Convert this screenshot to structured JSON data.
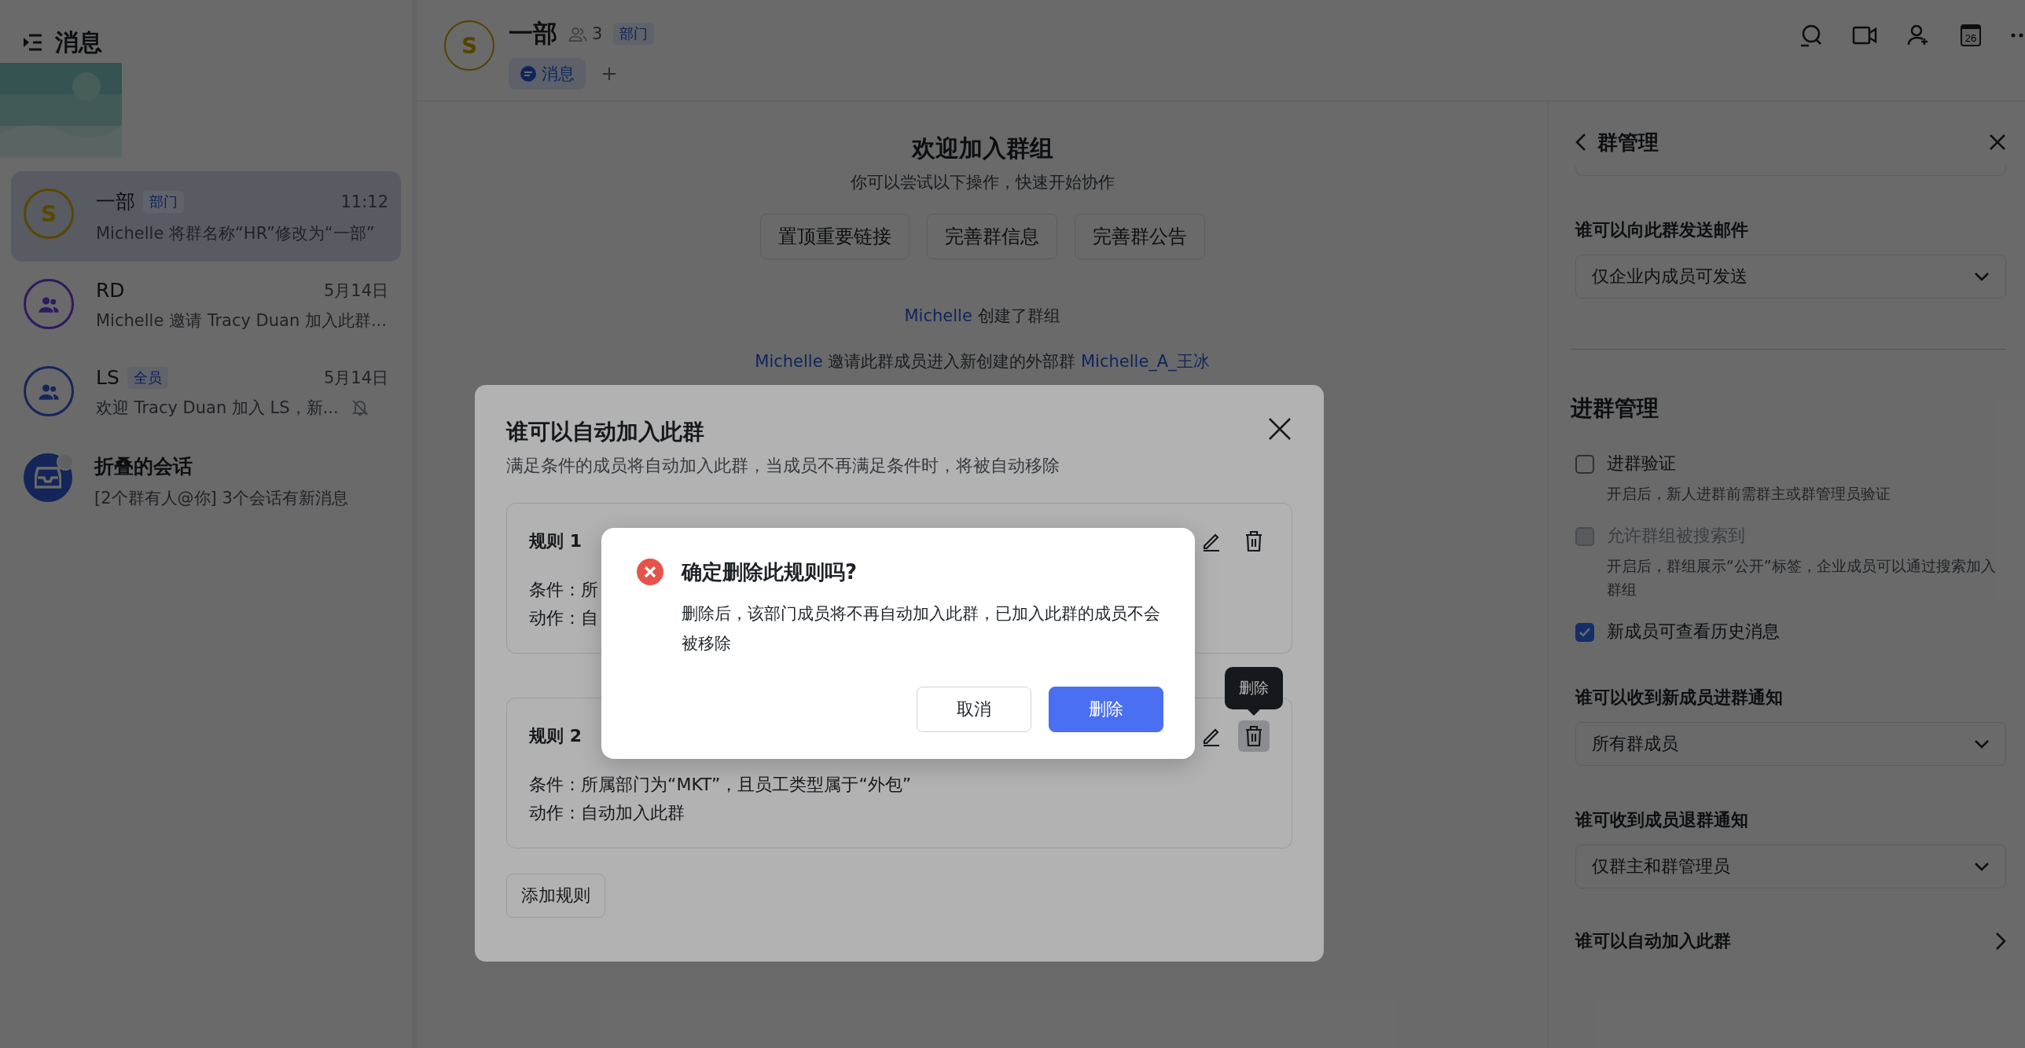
{
  "sidebar": {
    "title": "消息",
    "chats": [
      {
        "kind": "letter",
        "avatar_letter": "S",
        "color": "#5a4800",
        "name": "一部",
        "tag": "部门",
        "time": "11:12",
        "preview": "Michelle 将群名称“HR”修改为“一部”",
        "selected": true,
        "muted": false,
        "unread_dot": false
      },
      {
        "kind": "people",
        "color": "#2e1b60",
        "name": "RD",
        "time": "5月14日",
        "preview": "Michelle 邀请 Tracy Duan 加入此群...",
        "selected": false,
        "muted": false,
        "unread_dot": false
      },
      {
        "kind": "people",
        "color": "#16275c",
        "name": "LS",
        "tag": "全员",
        "time": "5月14日",
        "preview": "欢迎 Tracy Duan 加入 LS，新...",
        "selected": false,
        "muted": true,
        "unread_dot": false
      },
      {
        "kind": "folded",
        "color": "#14265a",
        "name": "折叠的会话",
        "preview": "[2个群有人@你] 3个会话有新消息",
        "selected": false,
        "muted": false,
        "unread_dot": true
      }
    ]
  },
  "chat": {
    "avatar_letter": "S",
    "title": "一部",
    "member_count": "3",
    "tag": "部门",
    "tabs": [
      {
        "label": "消息",
        "selected": true
      }
    ],
    "calendar_day": "26",
    "welcome": {
      "title": "欢迎加入群组",
      "subtitle": "你可以尝试以下操作，快速开始协作",
      "actions": [
        "置顶重要链接",
        "完善群信息",
        "完善群公告"
      ]
    },
    "events": [
      {
        "actor": "Michelle",
        "text": "创建了群组"
      },
      {
        "actor": "Michelle",
        "text": "邀请此群成员进入新创建的外部群",
        "target": "Michelle_A_王冰"
      }
    ]
  },
  "panel": {
    "title": "群管理",
    "items": [
      {
        "kind": "cutoff"
      },
      {
        "kind": "label",
        "text": "谁可以向此群发送邮件"
      },
      {
        "kind": "select",
        "value": "仅企业内成员可发送"
      },
      {
        "kind": "divider"
      },
      {
        "kind": "heading",
        "text": "进群管理"
      },
      {
        "kind": "checkbox",
        "label": "进群验证",
        "description": "开启后，新人进群前需群主或群管理员验证",
        "checked": false,
        "disabled": false
      },
      {
        "kind": "checkbox",
        "label": "允许群组被搜索到",
        "description": "开启后，群组展示“公开”标签，企业成员可以通过搜索加入群组",
        "checked": false,
        "disabled": true
      },
      {
        "kind": "checkbox",
        "label": "新成员可查看历史消息",
        "checked": true,
        "disabled": false
      },
      {
        "kind": "label",
        "text": "谁可以收到新成员进群通知"
      },
      {
        "kind": "select",
        "value": "所有群成员"
      },
      {
        "kind": "label",
        "text": "谁可收到成员退群通知"
      },
      {
        "kind": "select",
        "value": "仅群主和群管理员"
      },
      {
        "kind": "link",
        "text": "谁可以自动加入此群"
      }
    ]
  },
  "modal": {
    "title": "谁可以自动加入此群",
    "subtitle": "满足条件的成员将自动加入此群，当成员不再满足条件时，将被自动移除",
    "rules": [
      {
        "name": "规则 1",
        "condition_label": "条件：",
        "condition": "所",
        "action_label": "动作：",
        "action": "自",
        "delete_hovered": false
      },
      {
        "name": "规则 2",
        "condition_label": "条件：",
        "condition": "所属部门为“MKT”，且员工类型属于“外包”",
        "action_label": "动作：",
        "action": "自动加入此群",
        "delete_hovered": true,
        "tooltip": "删除"
      }
    ],
    "add_button": "添加规则"
  },
  "confirm": {
    "title": "确定删除此规则吗?",
    "message": "删除后，该部门成员将不再自动加入此群，已加入此群的成员不会被移除",
    "buttons": [
      {
        "label": "取消",
        "kind": "secondary"
      },
      {
        "label": "删除",
        "kind": "primary"
      }
    ]
  }
}
